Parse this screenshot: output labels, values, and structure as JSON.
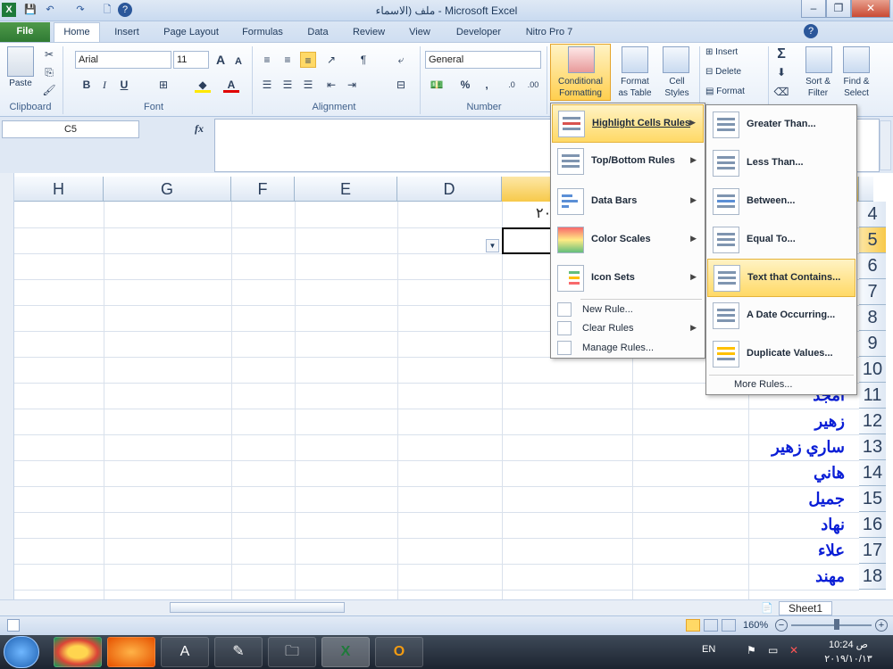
{
  "window": {
    "title": "ملف (الاسماء - Microsoft Excel",
    "minimize": "–",
    "restore": "❐",
    "close": "✕"
  },
  "qat": {
    "excel_icon": "X",
    "save": "💾",
    "undo": "↶",
    "redo": "↷",
    "new": "🗋",
    "help": "?"
  },
  "tabs": [
    {
      "label": "File"
    },
    {
      "label": "Home"
    },
    {
      "label": "Insert"
    },
    {
      "label": "Page Layout"
    },
    {
      "label": "Formulas"
    },
    {
      "label": "Data"
    },
    {
      "label": "Review"
    },
    {
      "label": "View"
    },
    {
      "label": "Developer"
    },
    {
      "label": "Nitro Pro 7"
    }
  ],
  "ribbon": {
    "clipboard": {
      "paste": "Paste",
      "label": "Clipboard"
    },
    "font": {
      "name": "Arial",
      "size": "11",
      "label": "Font",
      "bold": "B",
      "italic": "I",
      "underline": "U",
      "grow": "A",
      "shrink": "A"
    },
    "alignment": {
      "label": "Alignment"
    },
    "number": {
      "format": "General",
      "label": "Number",
      "percent": "%",
      "comma": ",",
      "inc": ".0",
      "dec": ".00"
    },
    "styles": {
      "conditional_line1": "Conditional",
      "conditional_line2": "Formatting",
      "format_table1": "Format",
      "format_table2": "as Table",
      "cell_styles1": "Cell",
      "cell_styles2": "Styles"
    },
    "cells": {
      "insert": "Insert",
      "delete": "Delete",
      "format": "Format"
    },
    "editing": {
      "sum": "Σ",
      "sort1": "Sort &",
      "sort2": "Filter",
      "find1": "Find &",
      "find2": "Select"
    }
  },
  "formula": {
    "name_box": "C5",
    "fx": "fx",
    "value": ""
  },
  "columns": [
    "H",
    "G",
    "F",
    "E",
    "D"
  ],
  "rows": [
    "4",
    "5",
    "6",
    "7",
    "8",
    "9",
    "10",
    "11",
    "12",
    "13",
    "14",
    "15",
    "16",
    "17",
    "18"
  ],
  "cells_visible": {
    "row4_partial": "٢٠",
    "row11": "امجد",
    "row12": "زهير",
    "row13": "ساري زهير",
    "row14": "هاني",
    "row15": "جميل",
    "row16": "نهاد",
    "row17": "علاء",
    "row18": "مهند"
  },
  "cf_menu": [
    {
      "label": "Highlight Cells Rules",
      "highlighted": true
    },
    {
      "label": "Top/Bottom Rules"
    },
    {
      "label": "Data Bars"
    },
    {
      "label": "Color Scales"
    },
    {
      "label": "Icon Sets"
    },
    {
      "label": "New Rule..."
    },
    {
      "label": "Clear Rules"
    },
    {
      "label": "Manage Rules..."
    }
  ],
  "submenu": [
    {
      "label": "Greater Than..."
    },
    {
      "label": "Less Than..."
    },
    {
      "label": "Between..."
    },
    {
      "label": "Equal To..."
    },
    {
      "label": "Text that Contains...",
      "highlighted": true
    },
    {
      "label": "A Date Occurring..."
    },
    {
      "label": "Duplicate Values..."
    },
    {
      "label": "More Rules..."
    }
  ],
  "sheet_tab": "Sheet1",
  "status": {
    "zoom": "160%"
  },
  "taskbar": {
    "lang": "EN",
    "time": "10:24 ص",
    "date": "٢٠١٩/١٠/١٣"
  },
  "colors": {
    "accent": "#2b579a",
    "highlight": "#ffd966",
    "arabic_text": "#0a1ed6"
  }
}
